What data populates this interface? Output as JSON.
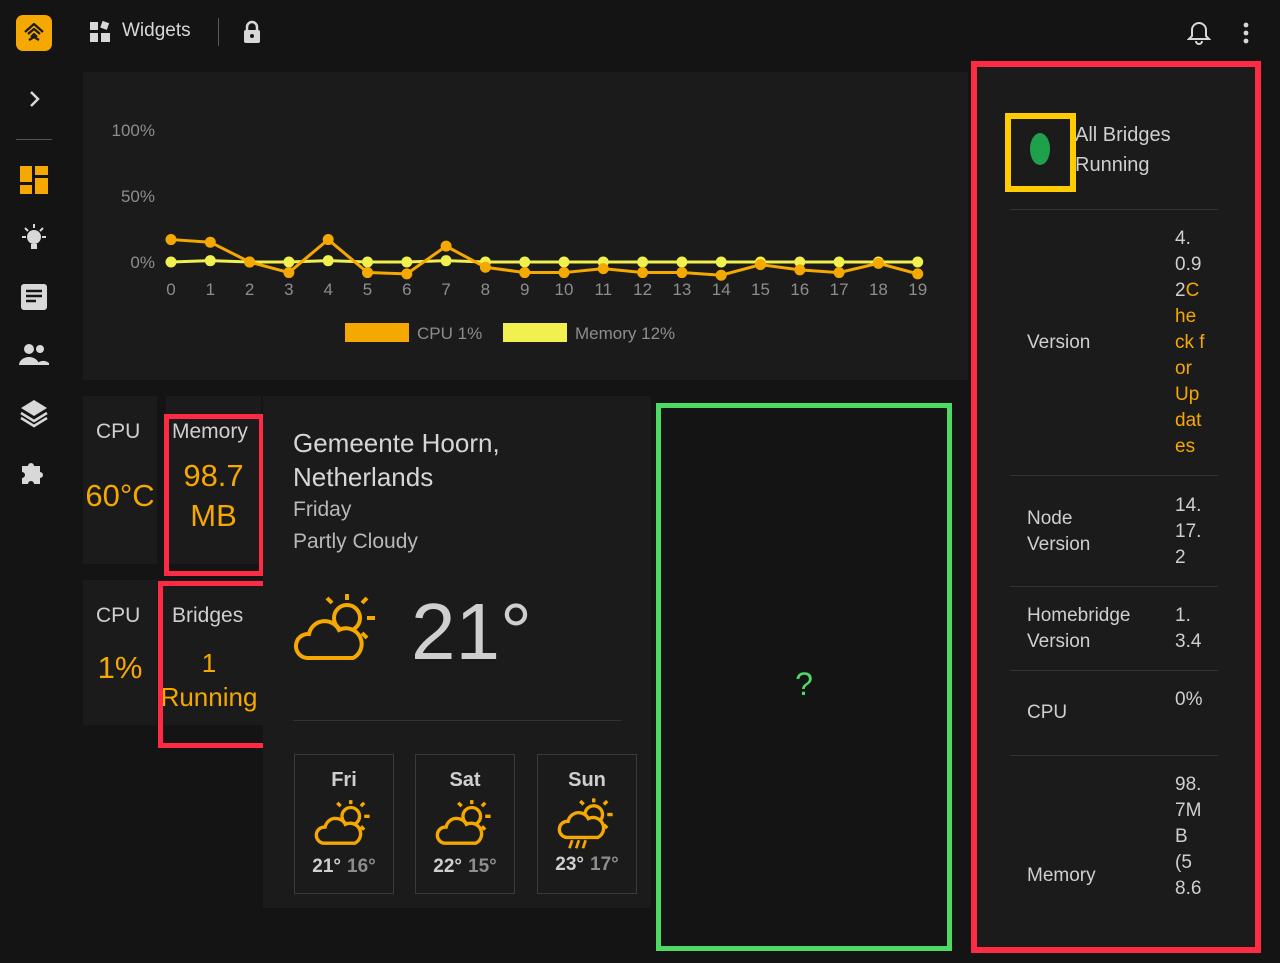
{
  "topbar": {
    "title": "Widgets"
  },
  "chart_data": {
    "type": "line",
    "x": [
      0,
      1,
      2,
      3,
      4,
      5,
      6,
      7,
      8,
      9,
      10,
      11,
      12,
      13,
      14,
      15,
      16,
      17,
      18,
      19
    ],
    "yticks": [
      "100%",
      "50%",
      "0%"
    ],
    "ylim": [
      0,
      100
    ],
    "series": [
      {
        "name": "CPU 1%",
        "color": "#f5a800",
        "values": [
          17,
          15,
          0,
          -8,
          17,
          -8,
          -9,
          12,
          -4,
          -8,
          -8,
          -5,
          -8,
          -8,
          -10,
          -2,
          -6,
          -8,
          -1,
          -9
        ]
      },
      {
        "name": "Memory 12%",
        "color": "#f0f050",
        "values": [
          0,
          1,
          0,
          0,
          1,
          0,
          0,
          1,
          0,
          0,
          0,
          0,
          0,
          0,
          0,
          0,
          0,
          0,
          0,
          0
        ]
      }
    ],
    "legend": "bottom"
  },
  "cards": {
    "cpu_temp": {
      "label": "CPU",
      "value": "60°C"
    },
    "memory": {
      "label": "Memory",
      "value_line1": "98.7",
      "value_line2": "MB"
    },
    "cpu_load": {
      "label": "CPU",
      "value": "1%"
    },
    "bridges": {
      "label": "Bridges",
      "value_line1": "1",
      "value_line2": "Running"
    }
  },
  "weather": {
    "location_line1": "Gemeente Hoorn,",
    "location_line2": "Netherlands",
    "day": "Friday",
    "condition": "Partly Cloudy",
    "temperature": "21°",
    "forecast": [
      {
        "day": "Fri",
        "high": "21°",
        "low": "16°",
        "icon": "partly-cloudy-icon"
      },
      {
        "day": "Sat",
        "high": "22°",
        "low": "15°",
        "icon": "partly-cloudy-icon"
      },
      {
        "day": "Sun",
        "high": "23°",
        "low": "17°",
        "icon": "rain-icon"
      }
    ]
  },
  "unknown_widget": {
    "text": "?"
  },
  "info": {
    "status_line1": "All Bridges",
    "status_line2": "Running",
    "status_color": "#1fa04a",
    "rows": [
      {
        "label": "Version",
        "value": "4.0.92",
        "link": "Check for Updates"
      },
      {
        "label": "Node Version",
        "value": "14.17.2"
      },
      {
        "label": "Homebridge Version",
        "value": "1.3.4"
      },
      {
        "label": "CPU",
        "value": "0%"
      },
      {
        "label": "Memory",
        "value": "98.7MB (58.6"
      }
    ]
  },
  "colors": {
    "accent": "#f5a800",
    "highlight_red": "#ff2b44",
    "highlight_green": "#4cd964",
    "highlight_yellow": "#ffcc00"
  }
}
